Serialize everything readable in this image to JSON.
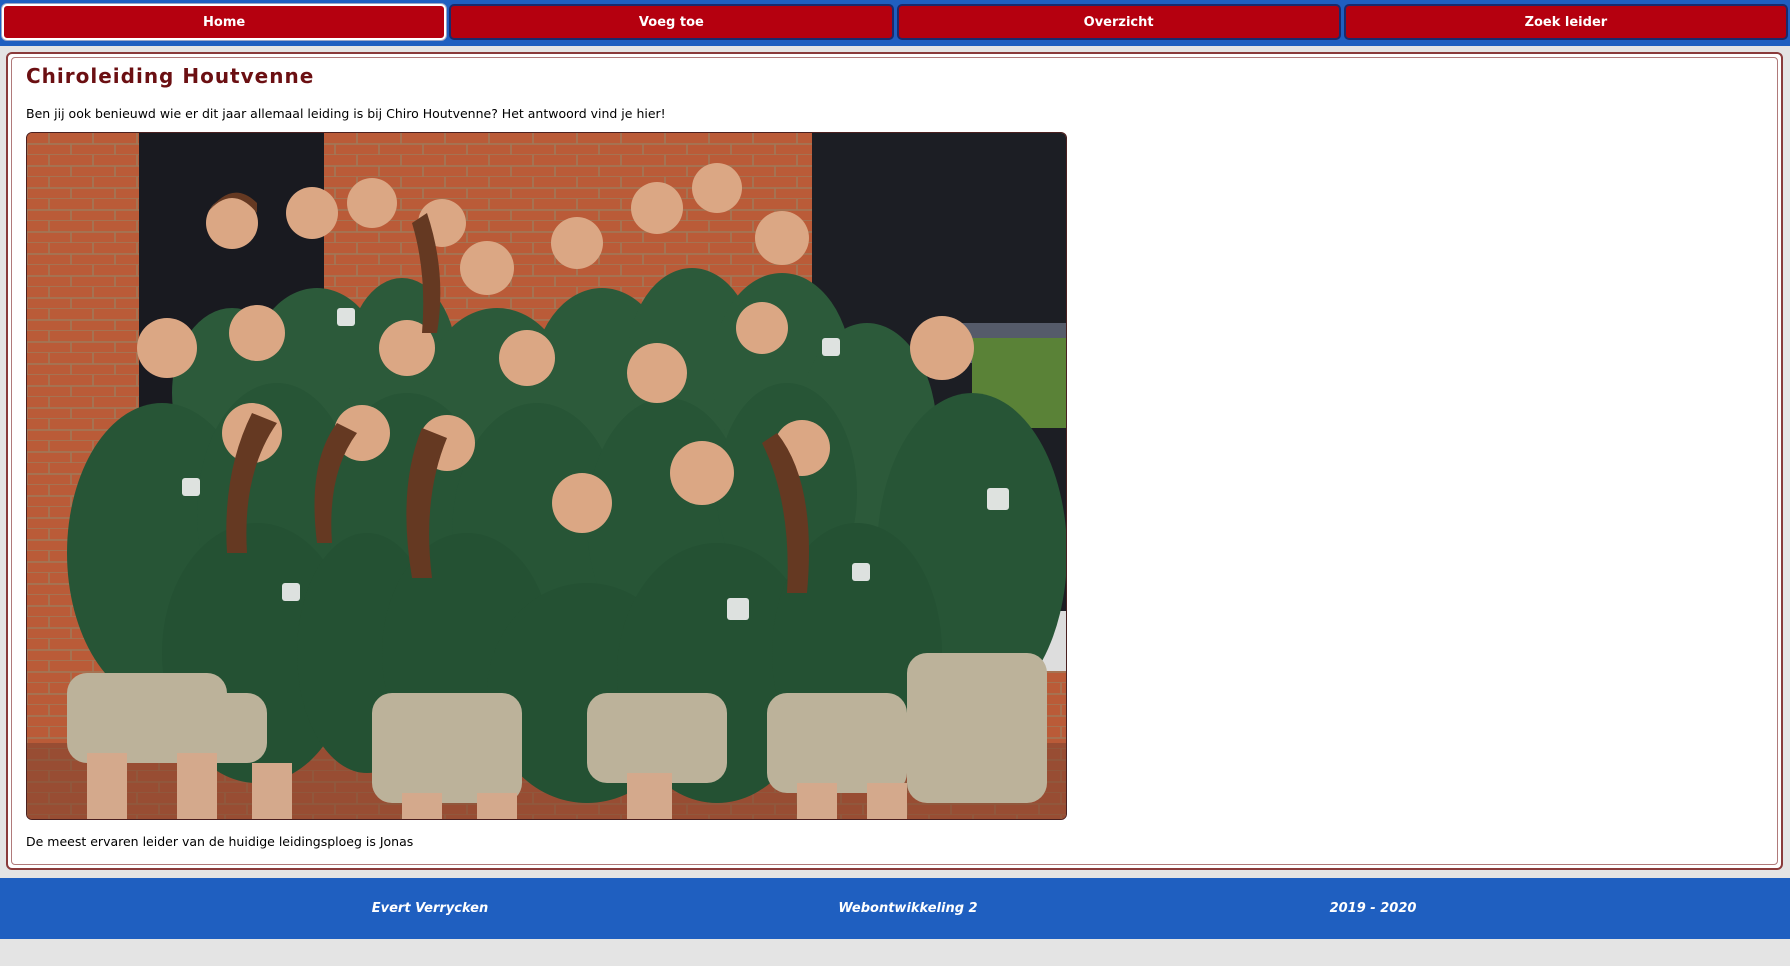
{
  "nav": {
    "items": [
      {
        "label": "Home",
        "active": true
      },
      {
        "label": "Voeg toe",
        "active": false
      },
      {
        "label": "Overzicht",
        "active": false
      },
      {
        "label": "Zoek leider",
        "active": false
      }
    ]
  },
  "main": {
    "title": "Chiroleiding Houtvenne",
    "intro": "Ben jij ook benieuwd wie er dit jaar allemaal leiding is bij Chiro Houtvenne? Het antwoord vind je hier!",
    "caption": "De meest ervaren leider van de huidige leidingsploeg is Jonas"
  },
  "footer": {
    "author": "Evert Verrycken",
    "course": "Webontwikkeling 2",
    "year": "2019 - 2020"
  },
  "colors": {
    "nav_bg": "#1f5fc0",
    "nav_button": "#b5000f",
    "title": "#6b0f12",
    "footer_bg": "#1f5fc0",
    "page_bg": "#e4e4e4"
  }
}
